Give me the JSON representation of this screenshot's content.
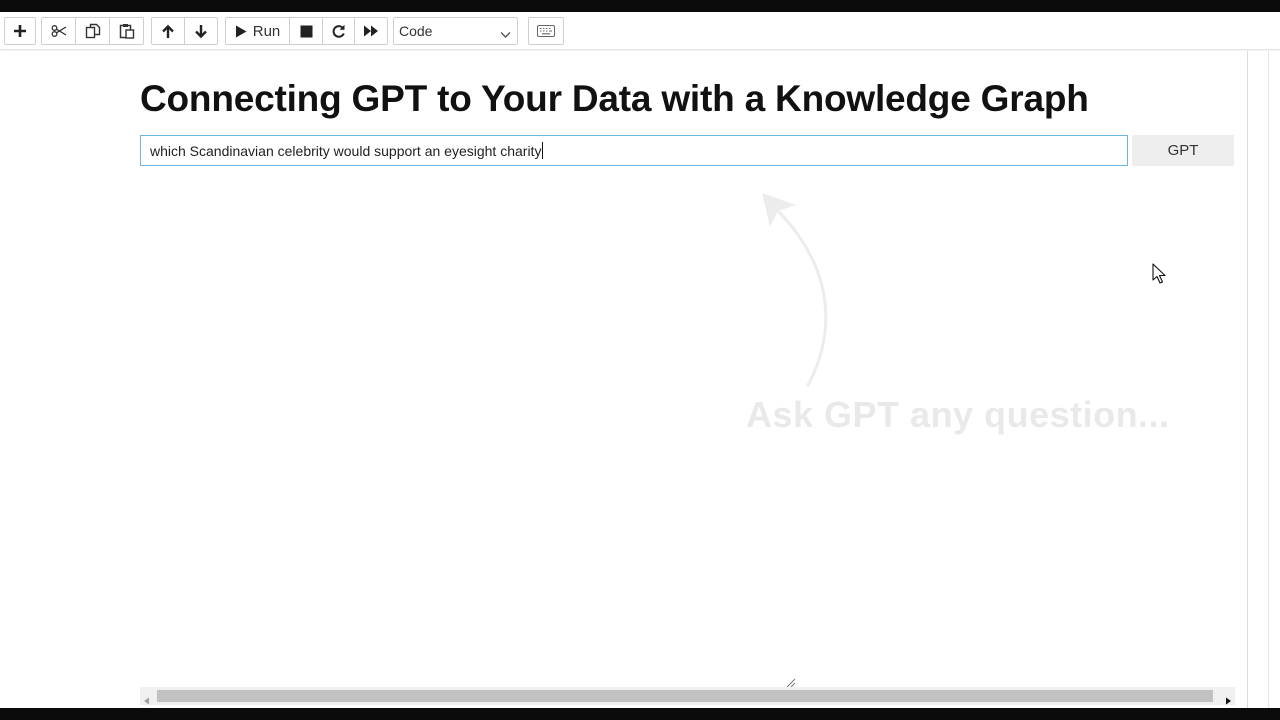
{
  "toolbar": {
    "buttons": [
      {
        "name": "insert-cell-button",
        "icon": "plus-icon"
      },
      {
        "name": "cut-cell-button",
        "icon": "scissors-icon"
      },
      {
        "name": "copy-cell-button",
        "icon": "copy-icon"
      },
      {
        "name": "paste-cell-button",
        "icon": "paste-icon"
      },
      {
        "name": "move-up-button",
        "icon": "arrow-up-icon"
      },
      {
        "name": "move-down-button",
        "icon": "arrow-down-icon"
      },
      {
        "name": "run-button",
        "icon": "play-icon"
      },
      {
        "name": "interrupt-button",
        "icon": "stop-icon"
      },
      {
        "name": "restart-button",
        "icon": "restart-icon"
      },
      {
        "name": "run-all-button",
        "icon": "fast-forward-icon"
      },
      {
        "name": "command-palette-button",
        "icon": "keyboard-icon"
      }
    ],
    "run_label": "Run",
    "cell_type": {
      "selected": "Code"
    }
  },
  "notebook": {
    "title": "Connecting GPT to Your Data with a Knowledge Graph",
    "question_input": {
      "value": "which Scandinavian celebrity would support an eyesight charity"
    },
    "gpt_button_label": "GPT",
    "hint_text": "Ask GPT any question...",
    "hint_icon": "curved-arrow-icon"
  },
  "colors": {
    "input_focus_border": "#6fb4de",
    "hint_text": "#e9e9e9",
    "button_bg": "#eeeeee"
  }
}
